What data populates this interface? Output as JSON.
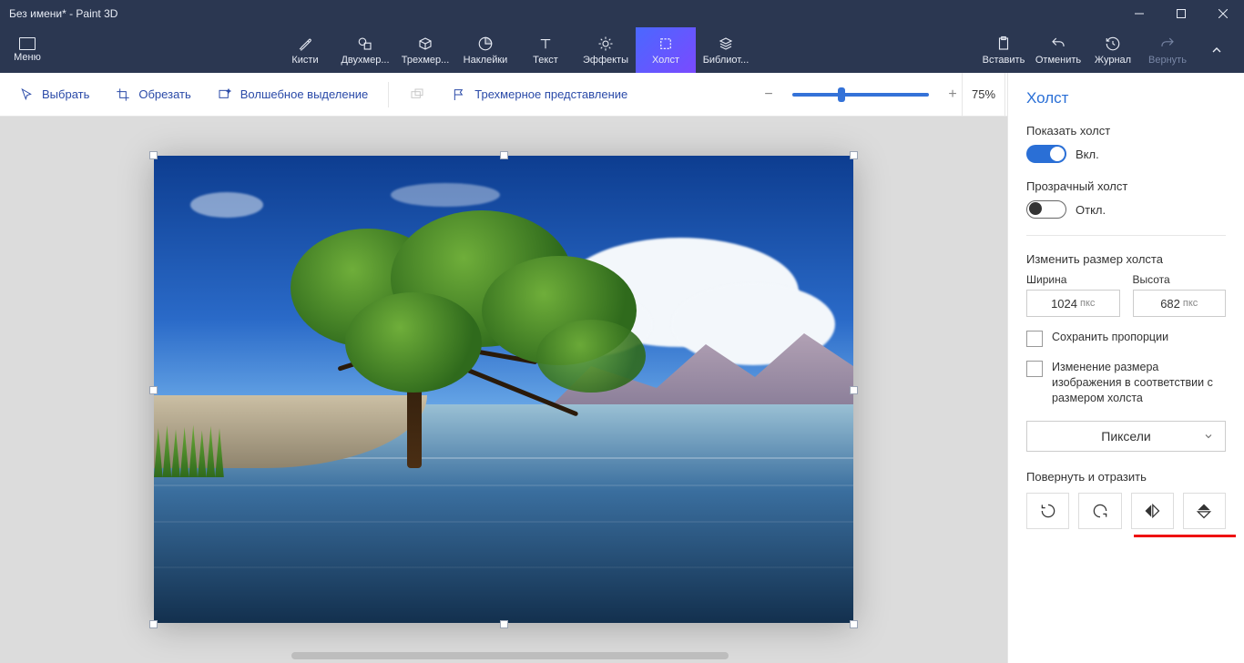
{
  "window": {
    "title": "Без имени* - Paint 3D"
  },
  "menu": {
    "label": "Меню"
  },
  "tabs": [
    {
      "id": "brushes",
      "label": "Кисти"
    },
    {
      "id": "2d",
      "label": "Двухмер..."
    },
    {
      "id": "3d",
      "label": "Трехмер..."
    },
    {
      "id": "stickers",
      "label": "Наклейки"
    },
    {
      "id": "text",
      "label": "Текст"
    },
    {
      "id": "effects",
      "label": "Эффекты"
    },
    {
      "id": "canvas",
      "label": "Холст",
      "active": true
    },
    {
      "id": "library",
      "label": "Библиот..."
    }
  ],
  "right_commands": {
    "paste": "Вставить",
    "undo": "Отменить",
    "history": "Журнал",
    "redo": "Вернуть"
  },
  "toolbar": {
    "select": "Выбрать",
    "crop": "Обрезать",
    "magicselect": "Волшебное выделение",
    "view3d": "Трехмерное представление",
    "zoom_percent": "75%",
    "slider_pos_pct": 33
  },
  "panel": {
    "title": "Холст",
    "show_canvas_label": "Показать холст",
    "show_canvas_state": "Вкл.",
    "transparent_label": "Прозрачный холст",
    "transparent_state": "Откл.",
    "resize_header": "Изменить размер холста",
    "width_label": "Ширина",
    "height_label": "Высота",
    "width_value": "1024",
    "height_value": "682",
    "unit_short": "пкс",
    "keep_aspect": "Сохранить пропорции",
    "resize_image_with_canvas": "Изменение размера изображения в соответствии с размером холста",
    "units_dropdown": "Пиксели",
    "rotate_flip_header": "Повернуть и отразить"
  }
}
